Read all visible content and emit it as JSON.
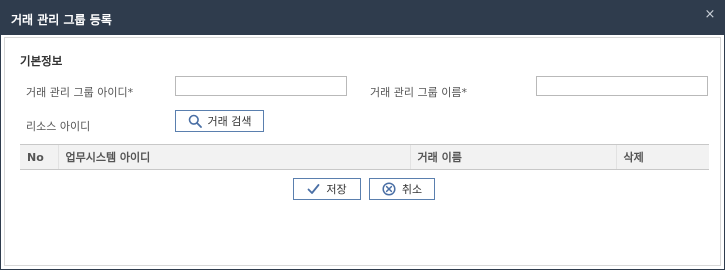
{
  "dialog": {
    "title": "거래 관리 그룹 등록",
    "close_glyph": "×"
  },
  "section": {
    "title": "기본정보"
  },
  "form": {
    "group_id_label": "거래 관리 그룹 아이디",
    "group_id_required": "*",
    "group_id_value": "",
    "group_name_label": "거래 관리 그룹 이름",
    "group_name_required": "*",
    "group_name_value": "",
    "resource_id_label": "리소스 아이디",
    "search_button_label": "거래 검색"
  },
  "table": {
    "columns": [
      "No",
      "업무시스템 아이디",
      "거래 이름",
      "삭제"
    ],
    "rows": []
  },
  "actions": {
    "save_label": "저장",
    "cancel_label": "취소"
  },
  "colors": {
    "titlebar": "#2f3c4d",
    "button_border": "#5a7fae",
    "icon": "#4a6fa5"
  },
  "icons": {
    "search": "search-icon",
    "save": "check-icon",
    "cancel": "cancel-circle-icon",
    "close": "close-icon"
  }
}
